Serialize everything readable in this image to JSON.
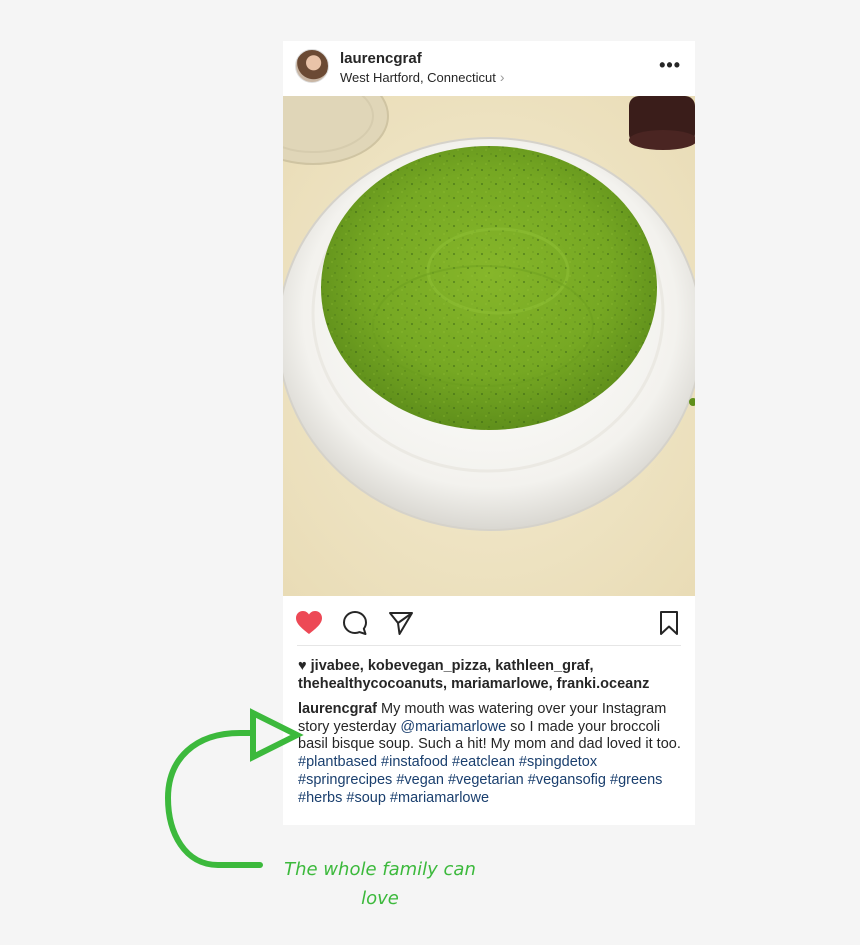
{
  "post": {
    "username": "laurencgraf",
    "location": "West Hartford, Connecticut",
    "more_icon": "ellipsis-icon",
    "actions": {
      "like": "heart-filled-icon",
      "comment": "comment-icon",
      "share": "paper-plane-icon",
      "save": "bookmark-icon",
      "like_color": "#ed4956"
    },
    "likes_line1": "jivabee, kobevegan_pizza, kathleen_graf,",
    "likes_line2": "thehealthycocoanuts, mariamarlowe, franki.oceanz",
    "caption": {
      "user": "laurencgraf",
      "text1": "My mouth was watering over your Instagram story yesterday",
      "mention": "@mariamarlowe",
      "text2": "so I made your broccoli basil bisque soup. Such a hit! My mom and dad loved it too.",
      "hashtags": [
        "#plantbased",
        "#instafood",
        "#eatclean",
        "#spingdetox",
        "#springrecipes",
        "#vegan",
        "#vegetarian",
        "#vegansofig",
        "#greens",
        "#herbs",
        "#soup",
        "#mariamarlowe"
      ]
    }
  },
  "annotation": {
    "line1": "The whole family can",
    "line2": "love",
    "color": "#3cb93c"
  }
}
